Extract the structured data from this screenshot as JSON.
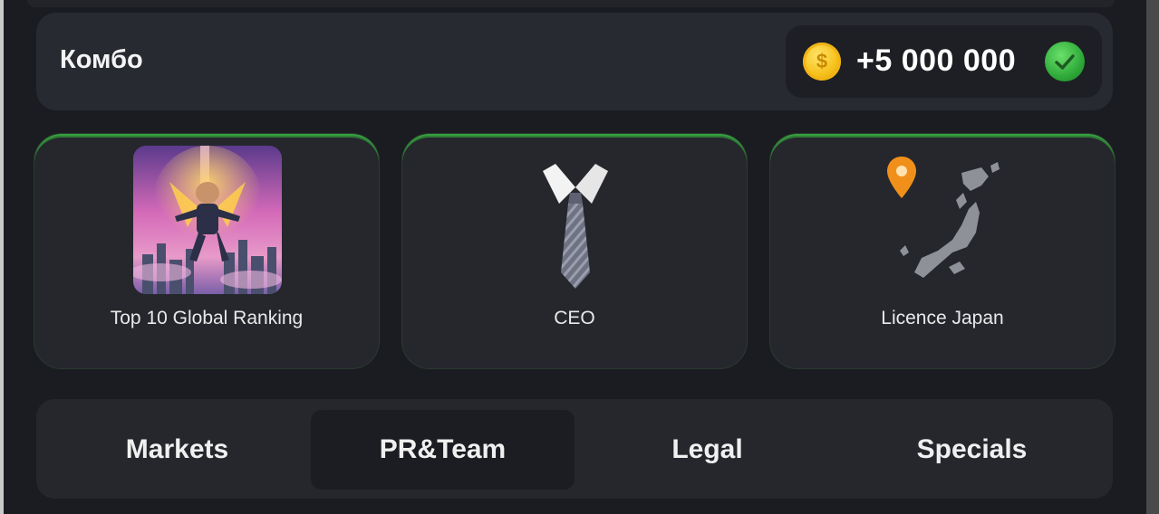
{
  "combo": {
    "title": "Комбо",
    "reward_amount": "+5 000 000",
    "coin_icon": "coin-icon",
    "status_icon": "check-circle-icon",
    "completed": true
  },
  "cards": [
    {
      "label": "Top 10 Global Ranking",
      "icon": "hamster-hero-image"
    },
    {
      "label": "CEO",
      "icon": "tie-icon"
    },
    {
      "label": "Licence Japan",
      "icon": "japan-map-icon"
    }
  ],
  "tabs": [
    {
      "label": "Markets",
      "active": false
    },
    {
      "label": "PR&Team",
      "active": true
    },
    {
      "label": "Legal",
      "active": false
    },
    {
      "label": "Specials",
      "active": false
    }
  ],
  "colors": {
    "background": "#1b1c21",
    "panel": "#272a31",
    "card_border_accent": "#35a040",
    "coin": "#f6c21c",
    "check": "#2faa3a"
  }
}
